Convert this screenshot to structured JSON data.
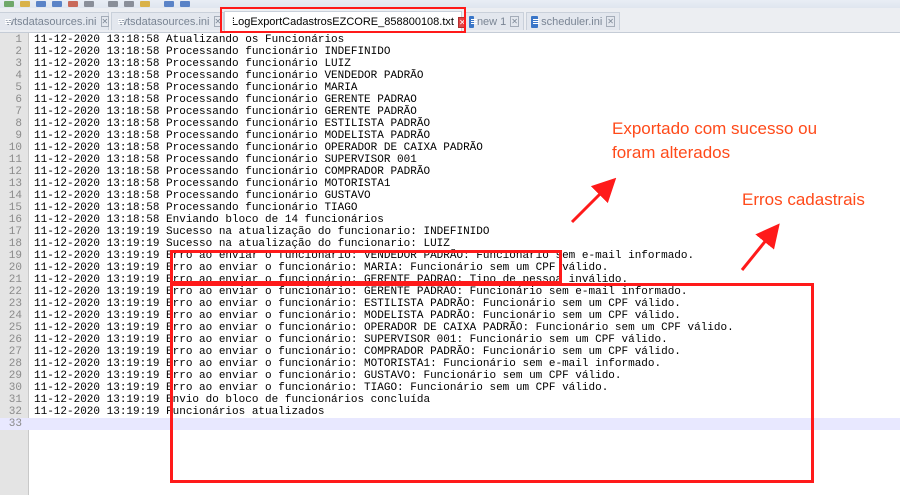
{
  "tabs": [
    {
      "label": "wtsdatasources.ini",
      "active": false
    },
    {
      "label": "wtsdatasources.ini",
      "active": false
    },
    {
      "label": "LogExportCadastrosEZCORE_858800108.txt",
      "active": true
    },
    {
      "label": "new 1",
      "active": false
    },
    {
      "label": "scheduler.ini",
      "active": false
    }
  ],
  "lines": [
    {
      "num": "1",
      "text": "11-12-2020 13:18:58 Atualizando os Funcionários"
    },
    {
      "num": "2",
      "text": "11-12-2020 13:18:58 Processando funcionário INDEFINIDO"
    },
    {
      "num": "3",
      "text": "11-12-2020 13:18:58 Processando funcionário LUIZ"
    },
    {
      "num": "4",
      "text": "11-12-2020 13:18:58 Processando funcionário VENDEDOR PADRÃO"
    },
    {
      "num": "5",
      "text": "11-12-2020 13:18:58 Processando funcionário MARIA"
    },
    {
      "num": "6",
      "text": "11-12-2020 13:18:58 Processando funcionário GERENTE PADRAO"
    },
    {
      "num": "7",
      "text": "11-12-2020 13:18:58 Processando funcionário GERENTE PADRÃO"
    },
    {
      "num": "8",
      "text": "11-12-2020 13:18:58 Processando funcionário ESTILISTA PADRÃO"
    },
    {
      "num": "9",
      "text": "11-12-2020 13:18:58 Processando funcionário MODELISTA PADRÃO"
    },
    {
      "num": "10",
      "text": "11-12-2020 13:18:58 Processando funcionário OPERADOR DE CAIXA PADRÃO"
    },
    {
      "num": "11",
      "text": "11-12-2020 13:18:58 Processando funcionário SUPERVISOR 001"
    },
    {
      "num": "12",
      "text": "11-12-2020 13:18:58 Processando funcionário COMPRADOR PADRÃO"
    },
    {
      "num": "13",
      "text": "11-12-2020 13:18:58 Processando funcionário MOTORISTA1"
    },
    {
      "num": "14",
      "text": "11-12-2020 13:18:58 Processando funcionário GUSTAVO"
    },
    {
      "num": "15",
      "text": "11-12-2020 13:18:58 Processando funcionário TIAGO"
    },
    {
      "num": "16",
      "text": "11-12-2020 13:18:58 Enviando bloco de 14 funcionários"
    },
    {
      "num": "17",
      "text": "11-12-2020 13:19:19 Sucesso na atualização do funcionario: INDEFINIDO"
    },
    {
      "num": "18",
      "text": "11-12-2020 13:19:19 Sucesso na atualização do funcionario: LUIZ"
    },
    {
      "num": "19",
      "text": "11-12-2020 13:19:19 Erro ao enviar o funcionário: VENDEDOR PADRÃO: Funcionário sem e-mail informado."
    },
    {
      "num": "20",
      "text": "11-12-2020 13:19:19 Erro ao enviar o funcionário: MARIA: Funcionário sem um CPF válido."
    },
    {
      "num": "21",
      "text": "11-12-2020 13:19:19 Erro ao enviar o funcionário: GERENTE PADRAO: Tipo de pessoa inválido."
    },
    {
      "num": "22",
      "text": "11-12-2020 13:19:19 Erro ao enviar o funcionário: GERENTE PADRÃO: Funcionário sem e-mail informado."
    },
    {
      "num": "23",
      "text": "11-12-2020 13:19:19 Erro ao enviar o funcionário: ESTILISTA PADRÃO: Funcionário sem um CPF válido."
    },
    {
      "num": "24",
      "text": "11-12-2020 13:19:19 Erro ao enviar o funcionário: MODELISTA PADRÃO: Funcionário sem um CPF válido."
    },
    {
      "num": "25",
      "text": "11-12-2020 13:19:19 Erro ao enviar o funcionário: OPERADOR DE CAIXA PADRÃO: Funcionário sem um CPF válido."
    },
    {
      "num": "26",
      "text": "11-12-2020 13:19:19 Erro ao enviar o funcionário: SUPERVISOR 001: Funcionário sem um CPF válido."
    },
    {
      "num": "27",
      "text": "11-12-2020 13:19:19 Erro ao enviar o funcionário: COMPRADOR PADRÃO: Funcionário sem um CPF válido."
    },
    {
      "num": "28",
      "text": "11-12-2020 13:19:19 Erro ao enviar o funcionário: MOTORISTA1: Funcionário sem e-mail informado."
    },
    {
      "num": "29",
      "text": "11-12-2020 13:19:19 Erro ao enviar o funcionário: GUSTAVO: Funcionário sem um CPF válido."
    },
    {
      "num": "30",
      "text": "11-12-2020 13:19:19 Erro ao enviar o funcionário: TIAGO: Funcionário sem um CPF válido."
    },
    {
      "num": "31",
      "text": "11-12-2020 13:19:19 Envio do bloco de funcionários concluída"
    },
    {
      "num": "32",
      "text": "11-12-2020 13:19:19 Funcionários atualizados"
    },
    {
      "num": "33",
      "text": ""
    }
  ],
  "annotations": {
    "success_line1": "Exportado com sucesso ou",
    "success_line2": "foram alterados",
    "errors": "Erros cadastrais"
  },
  "colors": {
    "annotation": "#ff4a1a",
    "highlight_box": "#ff1a1a",
    "current_line": "#e8e8ff"
  }
}
